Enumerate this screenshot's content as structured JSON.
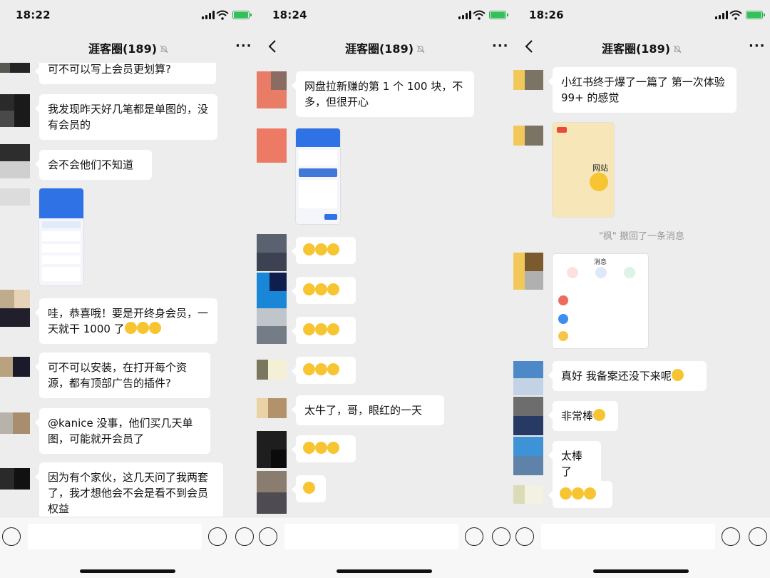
{
  "panels": [
    {
      "time": "18:22",
      "title": "涯客圈(189)",
      "messages": [
        {
          "type": "text",
          "text": "可不可以写上会员更划算?"
        },
        {
          "type": "text",
          "text": "我发现昨天好几笔都是单图的，没有会员的"
        },
        {
          "type": "text",
          "text": "会不会他们不知道"
        },
        {
          "type": "image",
          "caption": "app screenshot"
        },
        {
          "type": "text",
          "text": "哇，恭喜哦！要是开终身会员，一天就干 1000 了"
        },
        {
          "type": "text",
          "text": "可不可以安装，在打开每个资源，都有顶部广告的插件?"
        },
        {
          "type": "text",
          "text": "@kanice 没事，他们买几天单图，可能就开会员了"
        },
        {
          "type": "text",
          "text": "因为有个家伙，这几天问了我两套了，我才想他会不会是看不到会员权益"
        }
      ]
    },
    {
      "time": "18:24",
      "title": "涯客圈(189)",
      "messages": [
        {
          "type": "text",
          "text": "网盘拉新赚的第 1 个 100 块，不多，但很开心"
        },
        {
          "type": "image",
          "caption": "app screenshot"
        },
        {
          "type": "thumbs",
          "text": ""
        },
        {
          "type": "thumbs",
          "text": ""
        },
        {
          "type": "thumbs",
          "text": ""
        },
        {
          "type": "thumbs",
          "text": ""
        },
        {
          "type": "text",
          "text": "太牛了，哥，眼红的一天"
        },
        {
          "type": "thumbs",
          "text": ""
        },
        {
          "type": "emoji",
          "text": ""
        }
      ]
    },
    {
      "time": "18:26",
      "title": "涯客圈(189)",
      "messages": [
        {
          "type": "text",
          "text": "小红书终于爆了一篇了 第一次体验 99+ 的感觉"
        },
        {
          "type": "image",
          "caption": "网站"
        },
        {
          "type": "system",
          "text": "\"枫\" 撤回了一条消息"
        },
        {
          "type": "image",
          "caption": "消息"
        },
        {
          "type": "text",
          "text": "真好 我备案还没下来呢"
        },
        {
          "type": "text",
          "text": "非常棒"
        },
        {
          "type": "text",
          "text": "太棒了"
        },
        {
          "type": "thumbs",
          "text": ""
        }
      ]
    }
  ],
  "icons": {
    "back": "chevron-left-icon",
    "mute": "bell-mute-icon",
    "more": "more-icon",
    "voice": "voice-icon",
    "emoji": "emoji-icon",
    "plus": "plus-icon"
  },
  "colors": {
    "background": "#ededed",
    "bubble": "#ffffff",
    "battery": "#32c05a",
    "accent": "#1677ff"
  }
}
